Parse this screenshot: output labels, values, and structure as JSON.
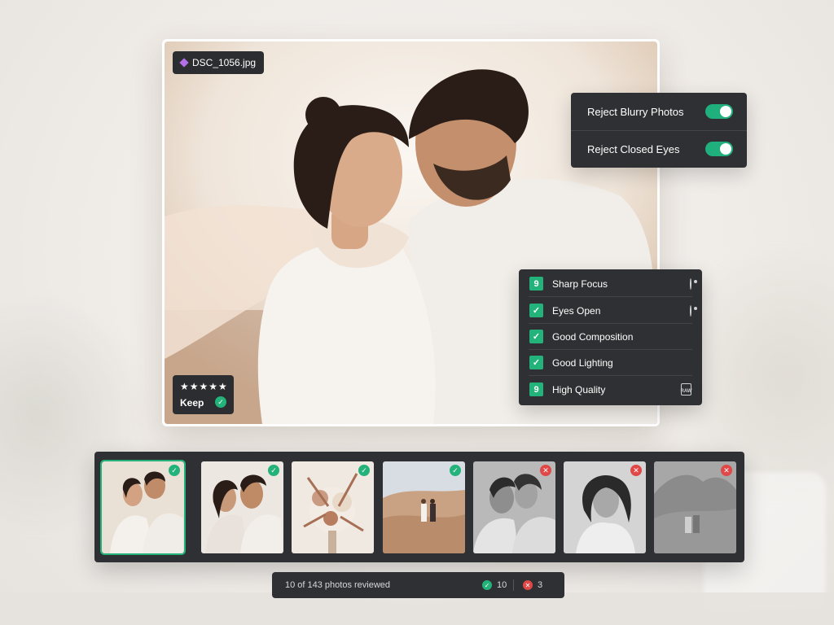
{
  "file": {
    "name": "DSC_1056.jpg"
  },
  "rating": {
    "stars": "★★★★★",
    "keep_label": "Keep"
  },
  "toggles": [
    {
      "label": "Reject Blurry Photos",
      "enabled": true
    },
    {
      "label": "Reject Closed Eyes",
      "enabled": true
    }
  ],
  "checks": [
    {
      "badge": "9",
      "label": "Sharp Focus",
      "icon": "eye-icon"
    },
    {
      "badge": "✓",
      "label": "Eyes Open",
      "icon": "eye-icon"
    },
    {
      "badge": "✓",
      "label": "Good Composition",
      "icon": ""
    },
    {
      "badge": "✓",
      "label": "Good Lighting",
      "icon": ""
    },
    {
      "badge": "9",
      "label": "High Quality",
      "icon": "raw-icon",
      "icon_text": "RAW"
    }
  ],
  "filmstrip": [
    {
      "status": "accepted",
      "mark": "✓"
    },
    {
      "status": "accepted",
      "mark": "✓"
    },
    {
      "status": "accepted",
      "mark": "✓"
    },
    {
      "status": "accepted",
      "mark": "✓"
    },
    {
      "status": "rejected",
      "mark": "✕"
    },
    {
      "status": "rejected",
      "mark": "✕"
    },
    {
      "status": "rejected",
      "mark": "✕"
    }
  ],
  "status": {
    "progress": "10  of 143 photos reviewed",
    "accepted_count": "10",
    "rejected_count": "3",
    "ok_mark": "✓",
    "no_mark": "✕"
  },
  "colors": {
    "accent": "#23b37a",
    "reject": "#e04848",
    "panel": "#2f3033",
    "file_icon": "#b36ee8"
  }
}
